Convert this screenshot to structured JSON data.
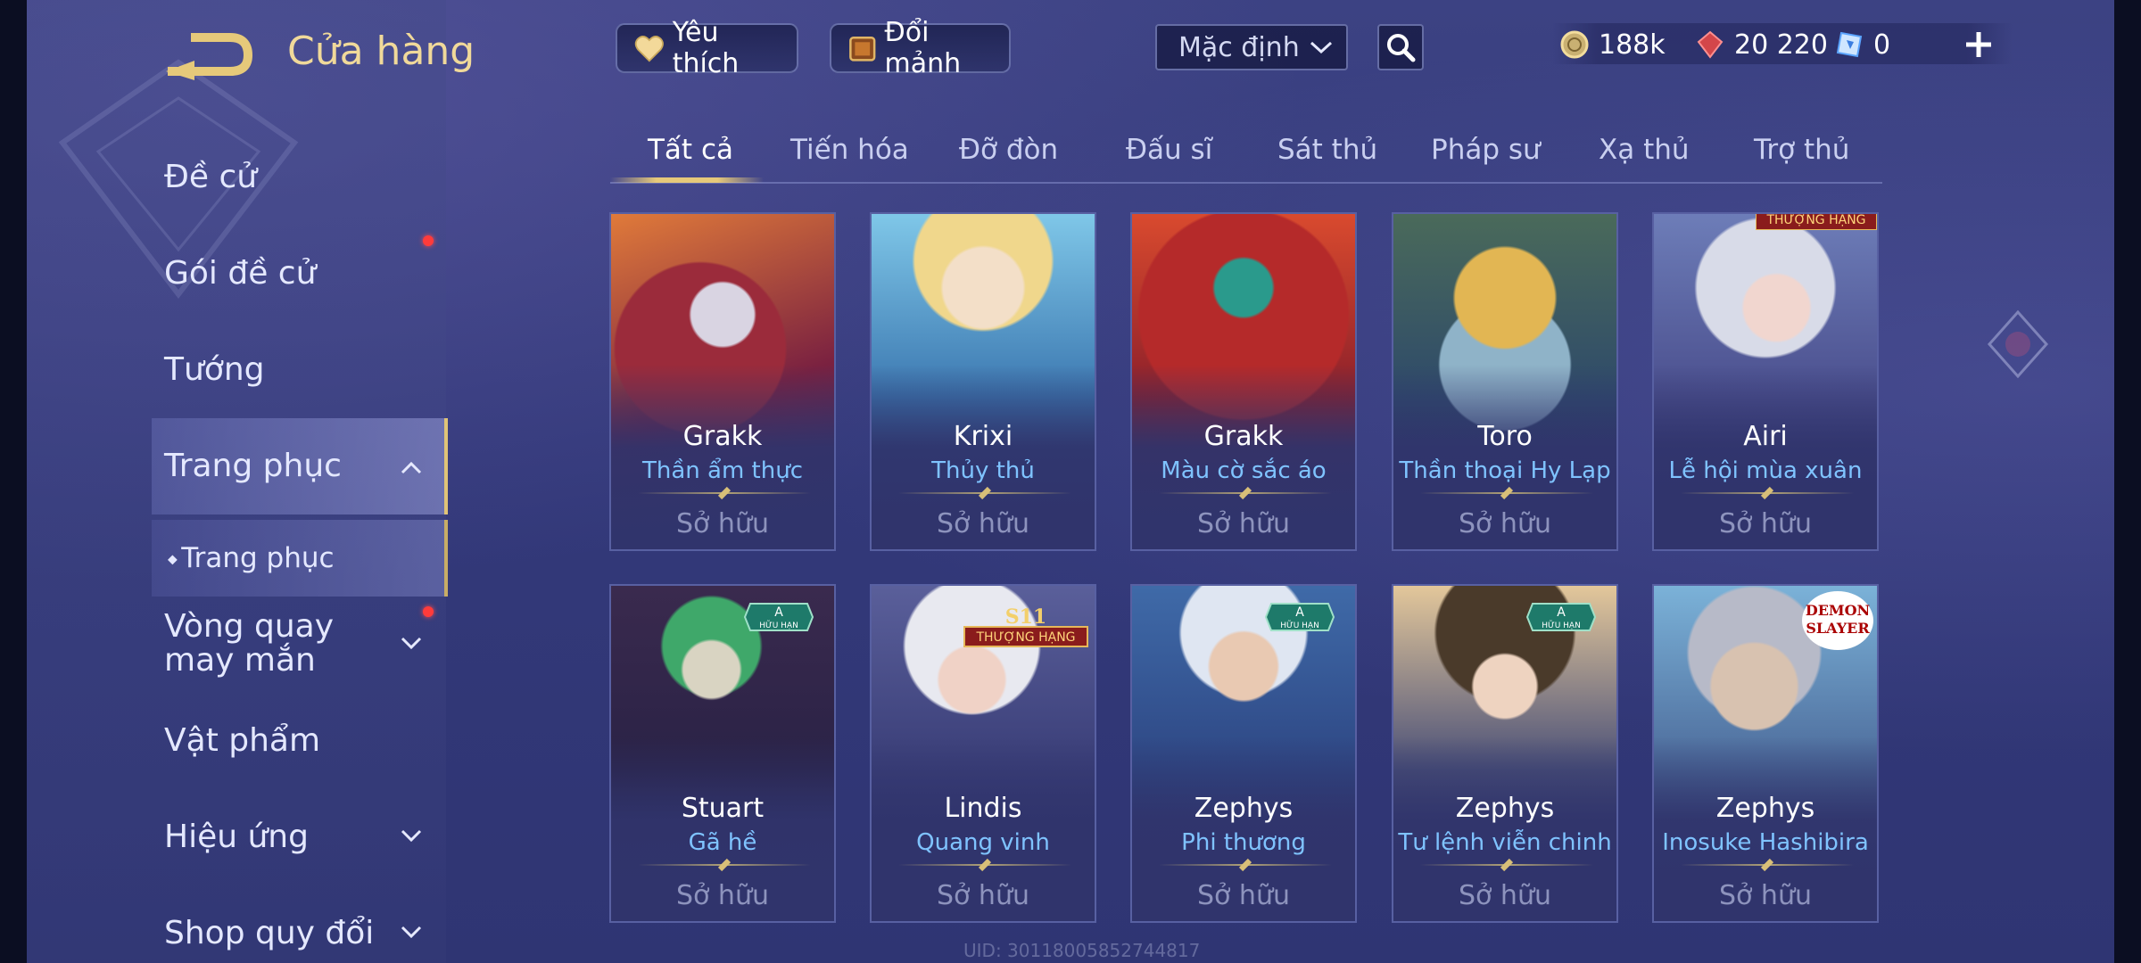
{
  "header": {
    "title": "Cửa hàng",
    "favorite_label": "Yêu thích",
    "trade_label": "Đổi mảnh",
    "sort_value": "Mặc định",
    "currency": {
      "gold": "188k",
      "gem": "20 220",
      "ticket": "0"
    }
  },
  "sidebar": {
    "items": [
      {
        "label": "Đề cử"
      },
      {
        "label": "Gói đề cử"
      },
      {
        "label": "Tướng"
      },
      {
        "label": "Trang phục"
      },
      {
        "label": "Trang phục"
      },
      {
        "label": "Vòng quay may mắn"
      },
      {
        "label": "Vật phẩm"
      },
      {
        "label": "Hiệu ứng"
      },
      {
        "label": "Shop quy đổi"
      }
    ]
  },
  "tabs": [
    {
      "label": "Tất cả",
      "active": true
    },
    {
      "label": "Tiến hóa"
    },
    {
      "label": "Đỡ đòn"
    },
    {
      "label": "Đấu sĩ"
    },
    {
      "label": "Sát thủ"
    },
    {
      "label": "Pháp sư"
    },
    {
      "label": "Xạ thủ"
    },
    {
      "label": "Trợ thủ"
    }
  ],
  "cards": [
    {
      "hero": "Grakk",
      "skin": "Thần ẩm thực",
      "status": "Sở hữu"
    },
    {
      "hero": "Krixi",
      "skin": "Thủy thủ",
      "status": "Sở hữu"
    },
    {
      "hero": "Grakk",
      "skin": "Màu cờ sắc áo",
      "status": "Sở hữu"
    },
    {
      "hero": "Toro",
      "skin": "Thần thoại Hy Lạp",
      "status": "Sở hữu"
    },
    {
      "hero": "Airi",
      "skin": "Lễ hội mùa xuân",
      "status": "Sở hữu",
      "badge": "THƯỢNG HẠNG"
    },
    {
      "hero": "Stuart",
      "skin": "Gã hề",
      "status": "Sở hữu",
      "badge": "A",
      "badge_sub": "HỮU HẠN"
    },
    {
      "hero": "Lindis",
      "skin": "Quang vinh",
      "status": "Sở hữu",
      "badge": "S11",
      "badge_sub": "THƯỢNG HẠNG"
    },
    {
      "hero": "Zephys",
      "skin": "Phi thương",
      "status": "Sở hữu",
      "badge": "A",
      "badge_sub": "HỮU HẠN"
    },
    {
      "hero": "Zephys",
      "skin": "Tư lệnh viễn chinh",
      "status": "Sở hữu",
      "badge": "A",
      "badge_sub": "HỮU HẠN"
    },
    {
      "hero": "Zephys",
      "skin": "Inosuke Hashibira",
      "status": "Sở hữu",
      "badge": "DEMON SLAYER"
    }
  ],
  "footer": {
    "uid": "UID: 30118005852744817"
  }
}
